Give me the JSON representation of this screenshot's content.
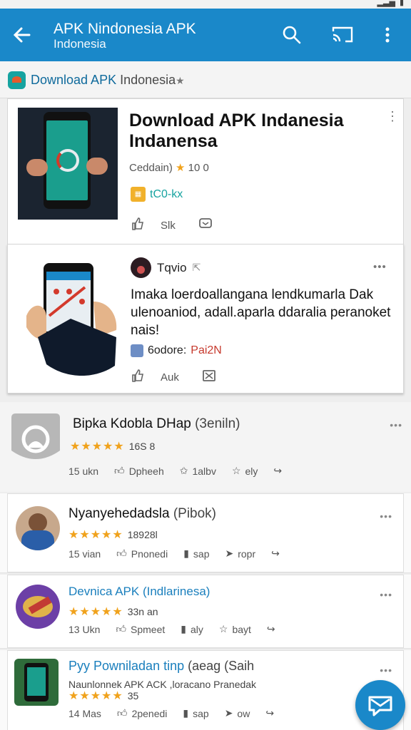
{
  "app_bar": {
    "title": "APK Nindonesia APK",
    "subtitle": "Indonesia",
    "color": "#1a88c9",
    "icons": [
      "back-arrow-icon",
      "search-icon",
      "cast-icon",
      "more-vert-icon"
    ]
  },
  "breadcrumb": {
    "text_main": "Download APK ",
    "text_muted": "Indonesia",
    "star": "★"
  },
  "featured": {
    "title_line1": "Download APK Indanesia",
    "title_line2": "Indanensa",
    "rating_label": "Ceddain)",
    "rating_value": "10 0",
    "badge_text": "tC0-kx",
    "like_count": "Slk"
  },
  "second": {
    "author": "Tqvio",
    "body": "Imaka loerdoallangana lendkumarla Dak ulenoaniod, adall.aparla ddaralia peranoket nais!",
    "source_label": "6odore:",
    "source_name": "Pai2N",
    "like_count": "Auk"
  },
  "list": [
    {
      "title": "Bipka Kdobla DHap",
      "paren": "(3eniln)",
      "stars": "★★★★★",
      "rating": "16S 8",
      "actions": [
        "15 ukn",
        "Dpheeh",
        "1albv",
        "ely"
      ],
      "accent": "#9e9e9e"
    },
    {
      "title": "Nyanyehedadsla",
      "paren": "(Pibok)",
      "stars": "★★★★★",
      "rating": "18928l",
      "actions": [
        "15 vian",
        "Pnonedi",
        "sap",
        "ropr"
      ],
      "accent": "#2a5ea8"
    },
    {
      "title": "Devnica APK",
      "paren": "(Indlarinesa)",
      "stars": "★★★★★",
      "rating": "33n an",
      "actions": [
        "13 Ukn",
        "Spmeet",
        "aly",
        "bayt"
      ],
      "accent": "#7a3ea0"
    },
    {
      "title": "Pyy Powniladan tinp",
      "paren": "(aeag (Saih",
      "subline": "Naunlonnek APK ACK ,loracano Pranedak",
      "stars": "★★★★★",
      "rating": "35",
      "actions": [
        "14 Mas",
        "2penedi",
        "sap",
        "ow"
      ],
      "accent": "#2e6b3a"
    }
  ]
}
